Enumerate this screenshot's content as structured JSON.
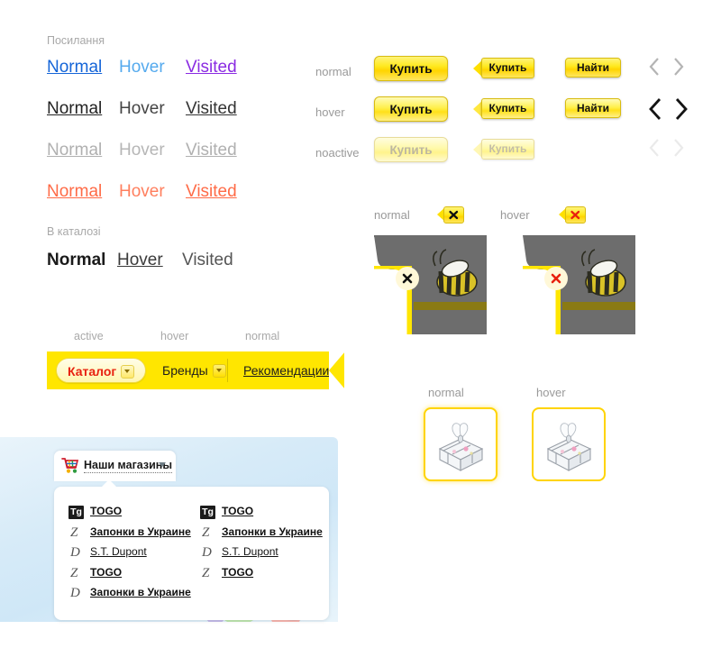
{
  "links_section": {
    "heading": "Посилання",
    "catalog_heading": "В каталозі",
    "rows": [
      {
        "normal": "Normal",
        "hover": "Hover",
        "visited": "Visited"
      },
      {
        "normal": "Normal",
        "hover": "Hover",
        "visited": "Visited"
      },
      {
        "normal": "Normal",
        "hover": "Hover",
        "visited": "Visited"
      },
      {
        "normal": "Normal",
        "hover": "Hover",
        "visited": "Visited"
      }
    ],
    "catalog_row": {
      "normal": "Normal",
      "hover": "Hover",
      "visited": "Visited"
    },
    "colors": {
      "row1_normal": "#1565d8",
      "row1_hover": "#55aaee",
      "row1_visited": "#8a2be2",
      "row2_normal": "#222222",
      "row3_normal": "#b0b0b0",
      "row4_normal": "#ff6b47"
    }
  },
  "buttons_section": {
    "states": [
      "normal",
      "hover",
      "noactive"
    ],
    "buy_label": "Купить",
    "tag_label": "Купить",
    "find_label": "Найти",
    "nav_prev_icon": "chevron-left-icon",
    "nav_next_icon": "chevron-right-icon",
    "accent": "#ffe600"
  },
  "close_section": {
    "states": [
      "normal",
      "hover"
    ],
    "close_icon": "close-x-icon",
    "normal_x_color": "#1a1a1a",
    "hover_x_color": "#e8210f",
    "panel_color": "#6d6d6d",
    "border_color": "#ffe600"
  },
  "tabs_section": {
    "captions": [
      "active",
      "hover",
      "normal"
    ],
    "tabs": [
      {
        "label": "Каталог",
        "state": "active",
        "has_caret": true
      },
      {
        "label": "Бренды",
        "state": "hover",
        "has_caret": true
      },
      {
        "label": "Рекомендации",
        "state": "normal",
        "has_caret": false
      }
    ],
    "bar_color": "#ffe600",
    "active_text_color": "#e8210f"
  },
  "shops_section": {
    "button_label": "Наши магазины",
    "cart_icon": "shopping-cart-icon",
    "caret_icon": "chevron-down-icon",
    "columns": [
      {
        "items": [
          {
            "logo": "Tg",
            "logo_kind": "tg",
            "name": "TOGO"
          },
          {
            "logo": "Z",
            "logo_kind": "z",
            "name": "Запонки в Украине"
          },
          {
            "logo": "D",
            "logo_kind": "d",
            "name": "S.T. Dupont"
          },
          {
            "logo": "Z",
            "logo_kind": "z",
            "name": "TOGO"
          },
          {
            "logo": "D",
            "logo_kind": "d",
            "name": "Запонки в Украине"
          }
        ]
      },
      {
        "items": [
          {
            "logo": "Tg",
            "logo_kind": "tg",
            "name": "TOGO"
          },
          {
            "logo": "Z",
            "logo_kind": "z",
            "name": "Запонки в Украине"
          },
          {
            "logo": "D",
            "logo_kind": "d",
            "name": "S.T. Dupont"
          },
          {
            "logo": "Z",
            "logo_kind": "z",
            "name": "TOGO"
          }
        ]
      }
    ]
  },
  "thumbs_section": {
    "captions": [
      "normal",
      "hover"
    ],
    "product_icon": "jewelry-box-thumbnail",
    "border_color": "#ffd400"
  }
}
